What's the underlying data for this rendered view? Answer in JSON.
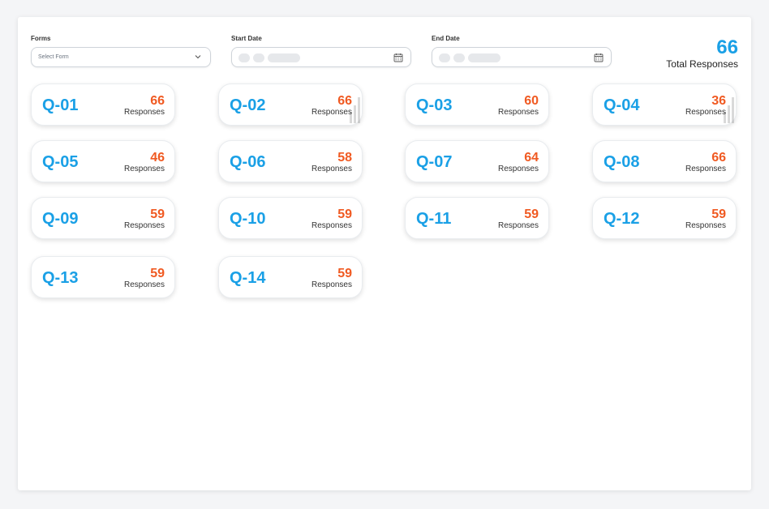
{
  "filters": {
    "forms_label": "Forms",
    "forms_placeholder": "Select Form",
    "start_label": "Start Date",
    "end_label": "End Date"
  },
  "total": {
    "value": "66",
    "label": "Total Responses"
  },
  "cards": [
    {
      "q": "Q-01",
      "count": "66",
      "label": "Responses"
    },
    {
      "q": "Q-02",
      "count": "66",
      "label": "Responses"
    },
    {
      "q": "Q-03",
      "count": "60",
      "label": "Responses"
    },
    {
      "q": "Q-04",
      "count": "36",
      "label": "Responses"
    },
    {
      "q": "Q-05",
      "count": "46",
      "label": "Responses"
    },
    {
      "q": "Q-06",
      "count": "58",
      "label": "Responses"
    },
    {
      "q": "Q-07",
      "count": "64",
      "label": "Responses"
    },
    {
      "q": "Q-08",
      "count": "66",
      "label": "Responses"
    },
    {
      "q": "Q-09",
      "count": "59",
      "label": "Responses"
    },
    {
      "q": "Q-10",
      "count": "59",
      "label": "Responses"
    },
    {
      "q": "Q-11",
      "count": "59",
      "label": "Responses"
    },
    {
      "q": "Q-12",
      "count": "59",
      "label": "Responses"
    },
    {
      "q": "Q-13",
      "count": "59",
      "label": "Responses"
    },
    {
      "q": "Q-14",
      "count": "59",
      "label": "Responses"
    }
  ],
  "colors": {
    "accent_blue": "#1aa0e6",
    "accent_orange": "#f05a22"
  },
  "icons": {
    "forms_dropdown": "chevron-down-icon",
    "date_picker": "calendar-icon"
  }
}
